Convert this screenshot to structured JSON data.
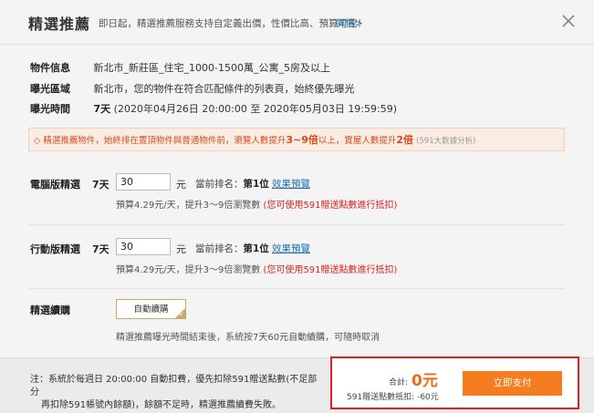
{
  "header": {
    "title": "精選推薦",
    "description": "即日起，精選推薦服務支持自定義出價，性價比高、預算可控！",
    "detail_link": "詳情>"
  },
  "info": [
    {
      "label": "物件信息",
      "value": "新北市_新莊區_住宅_1000-1500萬_公寓_5房及以上"
    },
    {
      "label": "曝光區域",
      "value": "新北市，您的物件在符合匹配條件的列表頁，始終優先曝光"
    },
    {
      "label": "曝光時間",
      "value_days": "7天",
      "value_range": "(2020年04月26日 20:00:00 至 2020年05月03日 19:59:59)"
    }
  ],
  "warning": {
    "prefix": "◇ 精選推薦物件，始終排在置頂物件與普通物件前，瀏覽人數提升",
    "highlight1": "3~9倍",
    "middle": "以上，實屋人數提升",
    "highlight2": "2倍",
    "suffix": "(591大數據分析)"
  },
  "pc": {
    "label": "電腦版精選",
    "days": "7天",
    "input_value": "30",
    "unit": "元",
    "rank_label": "當前排名：",
    "rank_value": "第1位",
    "preview": "效果預覽",
    "budget": "預算4.29元/天，提升3～9倍瀏覽數",
    "budget_note": "(您可使用591贈送點數進行抵扣)"
  },
  "mobile": {
    "label": "行動版精選",
    "days": "7天",
    "input_value": "30",
    "unit": "元",
    "rank_label": "當前排名：",
    "rank_value": "第1位",
    "preview": "效果預覽",
    "budget": "預算4.29元/天，提升3～9倍瀏覽數",
    "budget_note": "(您可使用591贈送點數進行抵扣)"
  },
  "renew": {
    "label": "精選續購",
    "button": "自動續購",
    "note": "精選推薦曝光時間結束後，系統按7天60元自動續購，可隨時取消"
  },
  "footer": {
    "note_line1": "注：系統於每週日 20:00:00 自動扣費，優先扣除591贈送點數(不足部分",
    "note_line2": "再扣除591帳號內餘額)，餘額不足時，精選推薦續費失敗。",
    "total_label": "合計:",
    "total_value": "0元",
    "deduct": "591贈送點數抵扣: -60元",
    "pay_button": "立即支付"
  },
  "colors": {
    "accent": "#f57d1f",
    "link": "#1a6fb3",
    "warning_text": "#d64b1e",
    "highlight_border": "#e02020"
  }
}
